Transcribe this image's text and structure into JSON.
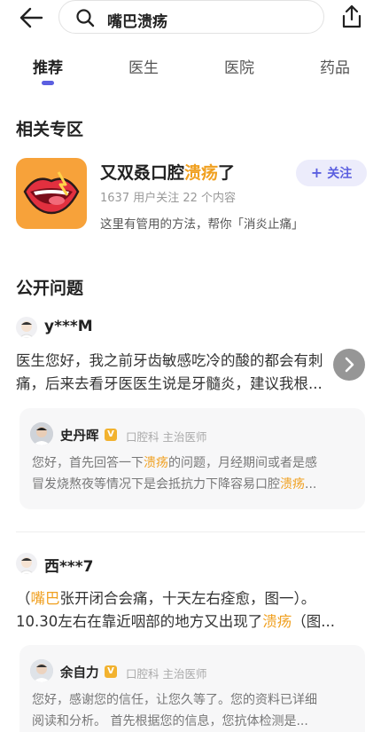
{
  "header": {
    "search_query": "嘴巴溃疡"
  },
  "tabs": [
    {
      "label": "推荐"
    },
    {
      "label": "医生"
    },
    {
      "label": "医院"
    },
    {
      "label": "药品"
    }
  ],
  "zone": {
    "section_title": "相关专区",
    "title_prefix": "又双叒口腔",
    "title_highlight": "溃疡",
    "title_suffix": "了",
    "stats": "1637 用户关注  22 个内容",
    "description": "这里有管用的方法，帮你「消炎止痛」",
    "follow_label": "关注"
  },
  "questions_section_title": "公开问题",
  "questions": [
    {
      "user": "y***M",
      "line1": "医生您好，我之前牙齿敏感吃冷的酸的都会有刺",
      "line2": "痛，后来去看牙医医生说是牙髓炎，建议我根...",
      "answer": {
        "doctor": "史丹晖",
        "dept": "口腔科  主治医师",
        "a1_pre": "您好，首先回答一下",
        "a1_hl": "溃疡",
        "a1_post": "的问题，月经期间或者是感",
        "a2_pre": "冒发烧熬夜等情况下是会抵抗力下降容易口腔",
        "a2_hl": "溃疡",
        "a2_post": "..."
      }
    },
    {
      "user": "西***7",
      "l1_pre": "（",
      "l1_hl": "嘴巴",
      "l1_post": "张开闭合会痛，十天左右痊愈，图一）。",
      "l2_pre": "10.30左右在靠近咽部的地方又出现了",
      "l2_hl": "溃疡",
      "l2_post": "（图...",
      "answer": {
        "doctor": "余自力",
        "dept": "口腔科  主治医师",
        "a1": "您好，感谢您的信任，让您久等了。您的资料已详细",
        "a2": "阅读和分析。  首先根据您的信息，您抗体检测是..."
      }
    }
  ],
  "colors": {
    "accent": "#5b5fe0",
    "highlight": "#f0a020",
    "zone_icon_bg": "#f7a23a"
  }
}
